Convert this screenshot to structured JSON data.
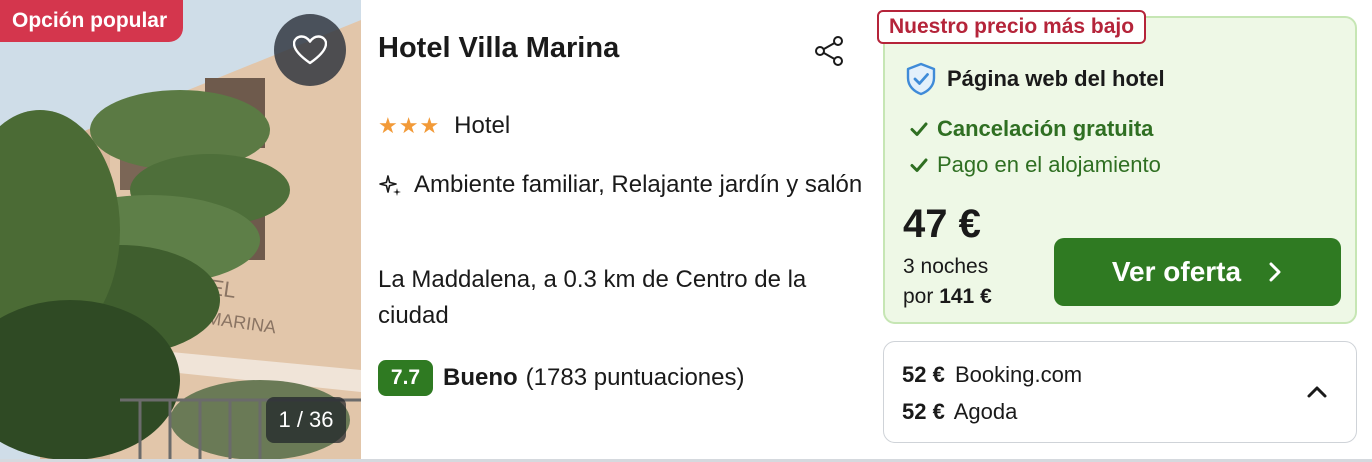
{
  "photo": {
    "badge": "Opción popular",
    "counter": "1 / 36",
    "sign_text_1": "OTEL",
    "sign_text_2": "LA MARINA"
  },
  "hotel": {
    "name": "Hotel Villa Marina",
    "stars": "★★★",
    "star_count": 3,
    "type": "Hotel",
    "features": "Ambiente familiar, Relajante jardín y salón",
    "location": "La Maddalena, a 0.3 km de Centro de la ciudad",
    "review": {
      "score": "7.7",
      "label": "Bueno",
      "count": "(1783 puntuaciones)"
    }
  },
  "offer": {
    "badge": "Nuestro precio más bajo",
    "provider": "Página web del hotel",
    "perks": [
      "Cancelación gratuita",
      "Pago en el alojamiento"
    ],
    "price": "47 €",
    "nights_line1": "3 noches",
    "nights_prefix": "por",
    "total": "141 €",
    "cta_label": "Ver oferta"
  },
  "other_offers": [
    {
      "price": "52 €",
      "provider": "Booking.com"
    },
    {
      "price": "52 €",
      "provider": "Agoda"
    }
  ],
  "colors": {
    "popular_badge": "#d4364d",
    "score_green": "#2f7a22",
    "cta_green": "#2f7a22",
    "offer_bg": "#eef8e6",
    "lowest_badge_red": "#b5243a",
    "star_orange": "#f29a38",
    "shield_blue": "#3f8bd8"
  },
  "icons": {
    "favorite": "heart-icon",
    "share": "share-icon",
    "features": "sparkle-icon",
    "verified": "shield-check-icon",
    "perk": "check-icon",
    "cta": "chevron-right-icon",
    "collapse": "chevron-up-icon"
  }
}
